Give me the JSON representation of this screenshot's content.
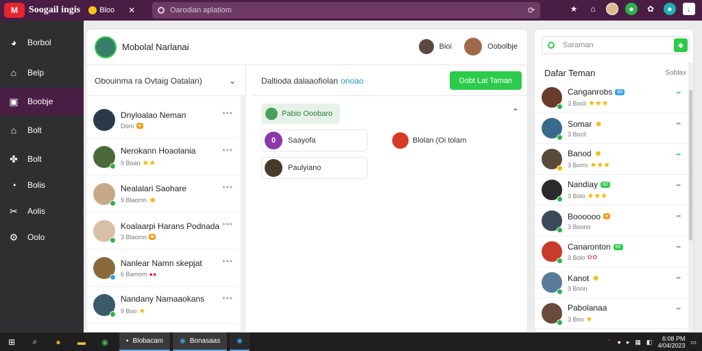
{
  "app": {
    "logo_text": "M",
    "title": "Soogail ingis",
    "emoji_chip": "Bloo",
    "search_placeholder": "Oarodian aplatiom"
  },
  "nav": {
    "items": [
      {
        "label": "Borbol",
        "icon": "globe-icon"
      },
      {
        "label": "Belp",
        "icon": "home-icon"
      },
      {
        "label": "Boobje",
        "icon": "inbox-icon"
      },
      {
        "label": "Bolt",
        "icon": "house-icon"
      },
      {
        "label": "Bolt",
        "icon": "share-icon"
      },
      {
        "label": "Bolis",
        "icon": "chat-icon"
      },
      {
        "label": "Aolis",
        "icon": "tools-icon"
      },
      {
        "label": "Oolo",
        "icon": "settings-icon"
      }
    ],
    "active_index": 2
  },
  "main": {
    "title": "Mobolal Narlanai",
    "header_users": [
      {
        "label": "Bioi"
      },
      {
        "label": "Oobolbje"
      }
    ],
    "list_header": "Obouinma ra Ovtaig Oatalan)",
    "conversations": [
      {
        "name": "Dnyloalao Neman",
        "sub": "Doro"
      },
      {
        "name": "Nerokann Hoaolania",
        "sub": "9 Boan"
      },
      {
        "name": "Nealalari Saohare",
        "sub": "9 Blaomn"
      },
      {
        "name": "Koalaarpi Harans Podnada",
        "sub": "3 Blaomn"
      },
      {
        "name": "Nanlear Namn skepjat",
        "sub": "6 Bamom"
      },
      {
        "name": "Nandany Namaaokans",
        "sub": "9 Boo"
      }
    ],
    "detail_header": "Daltioda dalaaofiolan",
    "detail_header_highlight": "onoao",
    "add_button": "Dobt Lat Taman",
    "group_label": "Pabio Ooobaro",
    "members": [
      {
        "name": "Saayofa",
        "initial": "0"
      },
      {
        "name": "Paulyiano"
      },
      {
        "name": "Blolan (Oi tolam"
      }
    ]
  },
  "right": {
    "search_placeholder": "Saraman",
    "title": "Dafar Teman",
    "more_label": "Soblax",
    "friends": [
      {
        "name": "Canganrobs",
        "badge": "60",
        "sub": "3 Bocli"
      },
      {
        "name": "Somar",
        "sub": "3 Bocli"
      },
      {
        "name": "Banod",
        "sub": "3 Borro"
      },
      {
        "name": "Nandiay",
        "badge": "60",
        "sub": "3 Bolo"
      },
      {
        "name": "Boooooo",
        "sub": "3 Boono"
      },
      {
        "name": "Canaronton",
        "badge": "60",
        "sub": "3 Bolo"
      },
      {
        "name": "Kanot",
        "sub": "3 Bonn"
      },
      {
        "name": "Pabolanaa",
        "sub": "3 Boo"
      }
    ]
  },
  "taskbar": {
    "apps": [
      "Blobacam",
      "Bonasaas"
    ],
    "time": "6:08 PM",
    "date": "4/04/2023"
  }
}
